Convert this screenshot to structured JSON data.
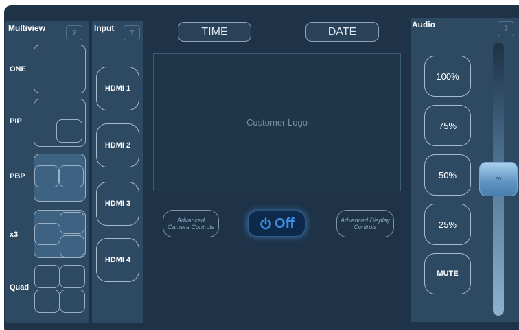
{
  "multiview": {
    "title": "Multiview",
    "help": "?",
    "modes": [
      {
        "label": "ONE"
      },
      {
        "label": "PIP"
      },
      {
        "label": "PBP"
      },
      {
        "label": "x3"
      },
      {
        "label": "Quad"
      }
    ]
  },
  "input": {
    "title": "Input",
    "help": "?",
    "sources": [
      {
        "label": "HDMI 1"
      },
      {
        "label": "HDMI 2"
      },
      {
        "label": "HDMI 3"
      },
      {
        "label": "HDMI 4"
      }
    ]
  },
  "center": {
    "time_label": "TIME",
    "date_label": "DATE",
    "logo_text": "Customer Logo",
    "camera_controls": "Advanced Camera Controls",
    "display_controls": "Advanced Display Controls",
    "power_label": "Off",
    "power_icon": "power-icon"
  },
  "audio": {
    "title": "Audio",
    "help": "?",
    "presets": [
      {
        "label": "100%"
      },
      {
        "label": "75%"
      },
      {
        "label": "50%"
      },
      {
        "label": "25%"
      },
      {
        "label": "MUTE"
      }
    ],
    "volume": {
      "value": 50,
      "display": "50"
    }
  },
  "colors": {
    "background": "#1e3347",
    "panel": "#2e4a63",
    "accent": "#5c88b3"
  }
}
